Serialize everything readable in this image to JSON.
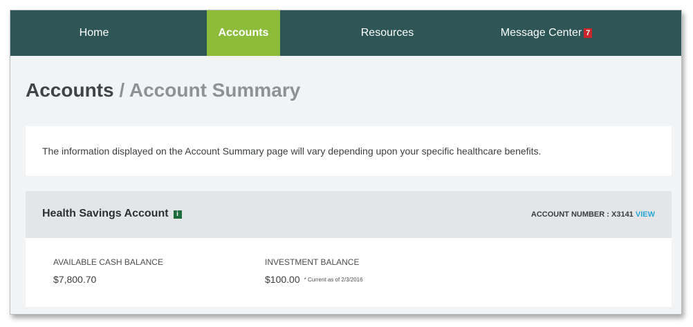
{
  "nav": {
    "items": [
      {
        "label": "Home"
      },
      {
        "label": "Accounts"
      },
      {
        "label": "Resources"
      },
      {
        "label": "Message Center"
      }
    ],
    "message_count": "7"
  },
  "page": {
    "section": "Accounts",
    "separator": "/",
    "subtitle": "Account Summary"
  },
  "info": {
    "text": "The information displayed on the Account Summary page will vary depending upon your specific healthcare benefits."
  },
  "hsa": {
    "title": "Health Savings Account",
    "info_icon": "i",
    "account_label": "ACCOUNT NUMBER : X3141",
    "view_label": "VIEW",
    "cash_label": "AVAILABLE CASH BALANCE",
    "cash_value": "$7,800.70",
    "investment_label": "INVESTMENT BALANCE",
    "investment_value": "$100.00",
    "investment_note": "* Current as of 2/3/2016"
  },
  "colors": {
    "nav_bg": "#2e5657",
    "nav_active": "#8dbc3a",
    "badge": "#c8262b",
    "link": "#2aa7d8"
  }
}
